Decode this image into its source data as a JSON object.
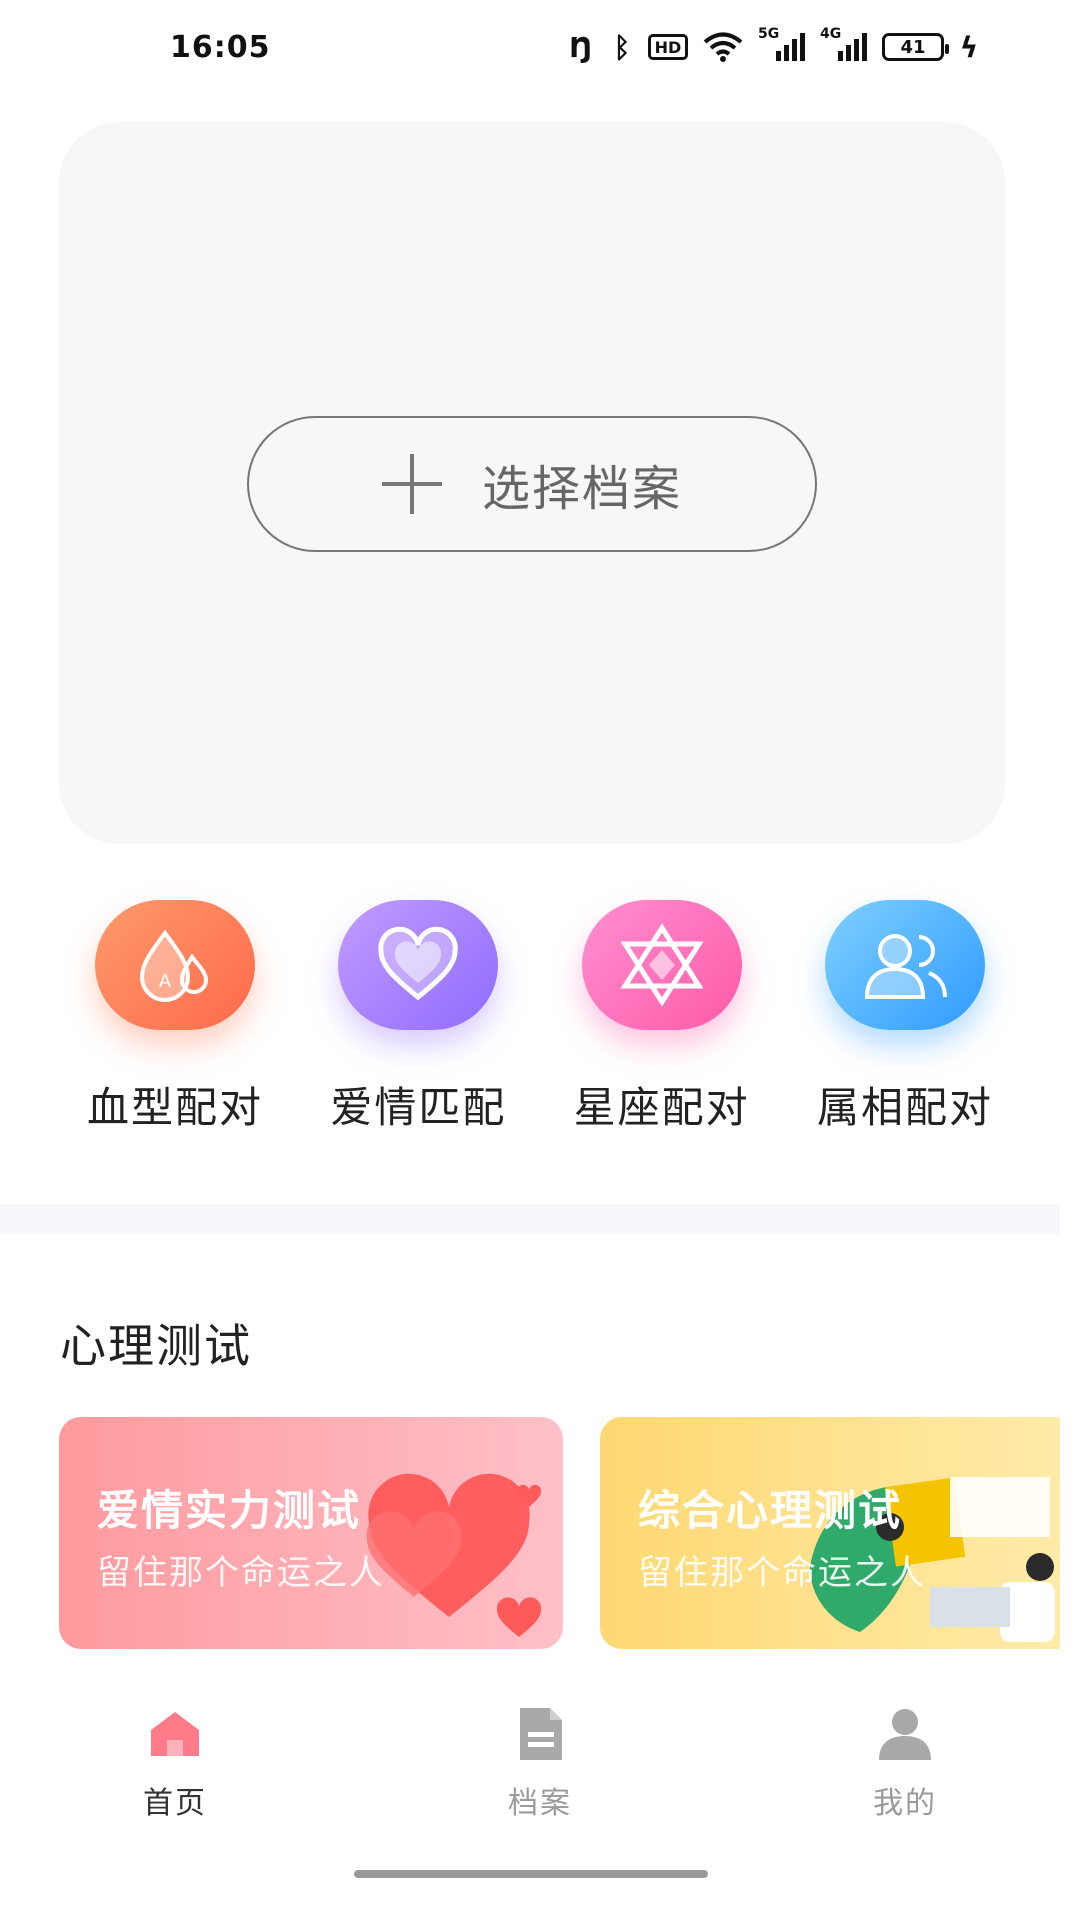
{
  "status_bar": {
    "time": "16:05",
    "hd_label": "HD",
    "sig1_label": "5G",
    "sig2_label": "4G",
    "battery": "41"
  },
  "archive": {
    "select_label": "选择档案"
  },
  "features": [
    {
      "label": "血型配对",
      "icon": "blood-drop-icon",
      "color": "#ff7a55"
    },
    {
      "label": "爱情匹配",
      "icon": "heart-icon",
      "color": "#9d77ff"
    },
    {
      "label": "星座配对",
      "icon": "star-of-david-icon",
      "color": "#ff5aa8"
    },
    {
      "label": "属相配对",
      "icon": "users-icon",
      "color": "#3aa0ff"
    }
  ],
  "section": {
    "title": "心理测试"
  },
  "tests": [
    {
      "title": "爱情实力测试",
      "subtitle": "留住那个命运之人"
    },
    {
      "title": "综合心理测试",
      "subtitle": "留住那个命运之人"
    }
  ],
  "nav": {
    "items": [
      {
        "label": "首页",
        "icon": "home-icon",
        "active": true,
        "color": "#ff7b8a"
      },
      {
        "label": "档案",
        "icon": "document-icon",
        "active": false
      },
      {
        "label": "我的",
        "icon": "profile-icon",
        "active": false
      }
    ]
  }
}
